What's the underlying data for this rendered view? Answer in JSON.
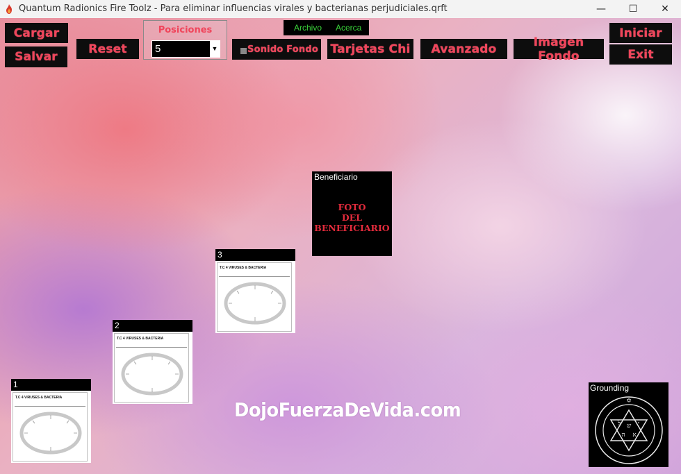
{
  "window": {
    "title": "Quantum Radionics Fire Toolz - Para eliminar influencias virales y bacterianas perjudiciales.qrft",
    "minimize": "—",
    "maximize": "☐",
    "close": "✕"
  },
  "toolbar": {
    "cargar": "Cargar",
    "salvar": "Salvar",
    "reset": "Reset",
    "posiciones_label": "Posiciones",
    "posiciones_value": "5",
    "sonido_fondo": "Sonido Fondo",
    "tarjetas_chi": "Tarjetas Chi",
    "avanzado": "Avanzado",
    "imagen_fondo": "Imagen Fondo",
    "iniciar": "Iniciar",
    "exit": "Exit"
  },
  "menu": {
    "archivo": "Archivo",
    "acerca": "Acerca"
  },
  "cards": [
    {
      "number": "1",
      "title": "T.C 4  VIRUSES & BACTERIA"
    },
    {
      "number": "2",
      "title": "T.C 4  VIRUSES & BACTERIA"
    },
    {
      "number": "3",
      "title": "T.C 4  VIRUSES & BACTERIA"
    }
  ],
  "beneficiario": {
    "label": "Beneficiario",
    "line1": "FOTO",
    "line2": "DEL",
    "line3": "BENEFICIARIO"
  },
  "grounding": {
    "label": "Grounding"
  },
  "watermark": "DojoFuerzaDeVida.com",
  "colors": {
    "button_bg": "#0d0d0d",
    "button_text": "#f0455b",
    "menu_text": "#3ad23a",
    "foto_text": "#e32b3c"
  }
}
